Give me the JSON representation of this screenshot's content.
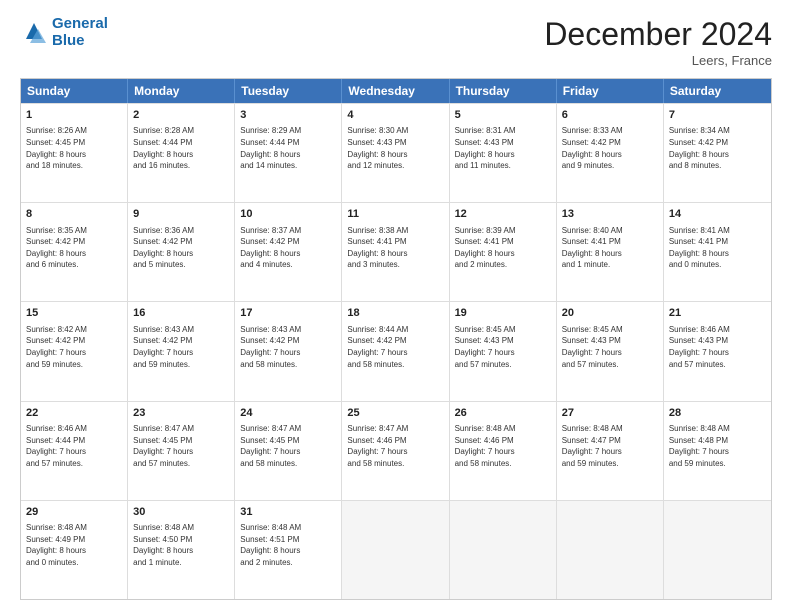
{
  "header": {
    "logo_line1": "General",
    "logo_line2": "Blue",
    "month": "December 2024",
    "location": "Leers, France"
  },
  "days_of_week": [
    "Sunday",
    "Monday",
    "Tuesday",
    "Wednesday",
    "Thursday",
    "Friday",
    "Saturday"
  ],
  "weeks": [
    [
      {
        "day": "1",
        "lines": [
          "Sunrise: 8:26 AM",
          "Sunset: 4:45 PM",
          "Daylight: 8 hours",
          "and 18 minutes."
        ]
      },
      {
        "day": "2",
        "lines": [
          "Sunrise: 8:28 AM",
          "Sunset: 4:44 PM",
          "Daylight: 8 hours",
          "and 16 minutes."
        ]
      },
      {
        "day": "3",
        "lines": [
          "Sunrise: 8:29 AM",
          "Sunset: 4:44 PM",
          "Daylight: 8 hours",
          "and 14 minutes."
        ]
      },
      {
        "day": "4",
        "lines": [
          "Sunrise: 8:30 AM",
          "Sunset: 4:43 PM",
          "Daylight: 8 hours",
          "and 12 minutes."
        ]
      },
      {
        "day": "5",
        "lines": [
          "Sunrise: 8:31 AM",
          "Sunset: 4:43 PM",
          "Daylight: 8 hours",
          "and 11 minutes."
        ]
      },
      {
        "day": "6",
        "lines": [
          "Sunrise: 8:33 AM",
          "Sunset: 4:42 PM",
          "Daylight: 8 hours",
          "and 9 minutes."
        ]
      },
      {
        "day": "7",
        "lines": [
          "Sunrise: 8:34 AM",
          "Sunset: 4:42 PM",
          "Daylight: 8 hours",
          "and 8 minutes."
        ]
      }
    ],
    [
      {
        "day": "8",
        "lines": [
          "Sunrise: 8:35 AM",
          "Sunset: 4:42 PM",
          "Daylight: 8 hours",
          "and 6 minutes."
        ]
      },
      {
        "day": "9",
        "lines": [
          "Sunrise: 8:36 AM",
          "Sunset: 4:42 PM",
          "Daylight: 8 hours",
          "and 5 minutes."
        ]
      },
      {
        "day": "10",
        "lines": [
          "Sunrise: 8:37 AM",
          "Sunset: 4:42 PM",
          "Daylight: 8 hours",
          "and 4 minutes."
        ]
      },
      {
        "day": "11",
        "lines": [
          "Sunrise: 8:38 AM",
          "Sunset: 4:41 PM",
          "Daylight: 8 hours",
          "and 3 minutes."
        ]
      },
      {
        "day": "12",
        "lines": [
          "Sunrise: 8:39 AM",
          "Sunset: 4:41 PM",
          "Daylight: 8 hours",
          "and 2 minutes."
        ]
      },
      {
        "day": "13",
        "lines": [
          "Sunrise: 8:40 AM",
          "Sunset: 4:41 PM",
          "Daylight: 8 hours",
          "and 1 minute."
        ]
      },
      {
        "day": "14",
        "lines": [
          "Sunrise: 8:41 AM",
          "Sunset: 4:41 PM",
          "Daylight: 8 hours",
          "and 0 minutes."
        ]
      }
    ],
    [
      {
        "day": "15",
        "lines": [
          "Sunrise: 8:42 AM",
          "Sunset: 4:42 PM",
          "Daylight: 7 hours",
          "and 59 minutes."
        ]
      },
      {
        "day": "16",
        "lines": [
          "Sunrise: 8:43 AM",
          "Sunset: 4:42 PM",
          "Daylight: 7 hours",
          "and 59 minutes."
        ]
      },
      {
        "day": "17",
        "lines": [
          "Sunrise: 8:43 AM",
          "Sunset: 4:42 PM",
          "Daylight: 7 hours",
          "and 58 minutes."
        ]
      },
      {
        "day": "18",
        "lines": [
          "Sunrise: 8:44 AM",
          "Sunset: 4:42 PM",
          "Daylight: 7 hours",
          "and 58 minutes."
        ]
      },
      {
        "day": "19",
        "lines": [
          "Sunrise: 8:45 AM",
          "Sunset: 4:43 PM",
          "Daylight: 7 hours",
          "and 57 minutes."
        ]
      },
      {
        "day": "20",
        "lines": [
          "Sunrise: 8:45 AM",
          "Sunset: 4:43 PM",
          "Daylight: 7 hours",
          "and 57 minutes."
        ]
      },
      {
        "day": "21",
        "lines": [
          "Sunrise: 8:46 AM",
          "Sunset: 4:43 PM",
          "Daylight: 7 hours",
          "and 57 minutes."
        ]
      }
    ],
    [
      {
        "day": "22",
        "lines": [
          "Sunrise: 8:46 AM",
          "Sunset: 4:44 PM",
          "Daylight: 7 hours",
          "and 57 minutes."
        ]
      },
      {
        "day": "23",
        "lines": [
          "Sunrise: 8:47 AM",
          "Sunset: 4:45 PM",
          "Daylight: 7 hours",
          "and 57 minutes."
        ]
      },
      {
        "day": "24",
        "lines": [
          "Sunrise: 8:47 AM",
          "Sunset: 4:45 PM",
          "Daylight: 7 hours",
          "and 58 minutes."
        ]
      },
      {
        "day": "25",
        "lines": [
          "Sunrise: 8:47 AM",
          "Sunset: 4:46 PM",
          "Daylight: 7 hours",
          "and 58 minutes."
        ]
      },
      {
        "day": "26",
        "lines": [
          "Sunrise: 8:48 AM",
          "Sunset: 4:46 PM",
          "Daylight: 7 hours",
          "and 58 minutes."
        ]
      },
      {
        "day": "27",
        "lines": [
          "Sunrise: 8:48 AM",
          "Sunset: 4:47 PM",
          "Daylight: 7 hours",
          "and 59 minutes."
        ]
      },
      {
        "day": "28",
        "lines": [
          "Sunrise: 8:48 AM",
          "Sunset: 4:48 PM",
          "Daylight: 7 hours",
          "and 59 minutes."
        ]
      }
    ],
    [
      {
        "day": "29",
        "lines": [
          "Sunrise: 8:48 AM",
          "Sunset: 4:49 PM",
          "Daylight: 8 hours",
          "and 0 minutes."
        ]
      },
      {
        "day": "30",
        "lines": [
          "Sunrise: 8:48 AM",
          "Sunset: 4:50 PM",
          "Daylight: 8 hours",
          "and 1 minute."
        ]
      },
      {
        "day": "31",
        "lines": [
          "Sunrise: 8:48 AM",
          "Sunset: 4:51 PM",
          "Daylight: 8 hours",
          "and 2 minutes."
        ]
      },
      null,
      null,
      null,
      null
    ]
  ]
}
